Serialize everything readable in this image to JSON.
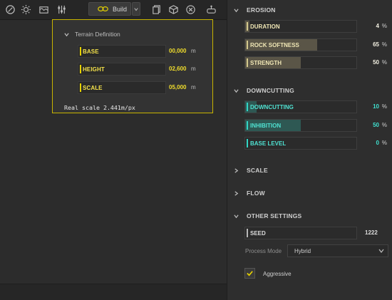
{
  "toolbar": {
    "icons": [
      "gauge-icon",
      "sun-icon",
      "terrain-graph-icon",
      "sliders-icon",
      "chain-link-icon",
      "chevron-down-icon",
      "copy-icon",
      "cube-icon",
      "close-circle-icon",
      "camera-pin-icon"
    ],
    "build_label": "Build"
  },
  "terrain": {
    "title": "Terrain Definition",
    "fields": [
      {
        "label": "BASE",
        "value": "00,000",
        "unit": "m"
      },
      {
        "label": "HEIGHT",
        "value": "02,600",
        "unit": "m"
      },
      {
        "label": "SCALE",
        "value": "05,000",
        "unit": "m"
      }
    ],
    "real_scale": "Real scale 2.441m/px"
  },
  "panel": {
    "erosion": {
      "title": "EROSION",
      "params": [
        {
          "label": "DURATION",
          "value": "4",
          "unit": "%",
          "fill": 0.04
        },
        {
          "label": "ROCK SOFTNESS",
          "value": "65",
          "unit": "%",
          "fill": 0.65
        },
        {
          "label": "STRENGTH",
          "value": "50",
          "unit": "%",
          "fill": 0.5
        }
      ]
    },
    "downcutting": {
      "title": "DOWNCUTTING",
      "params": [
        {
          "label": "DOWNCUTTING",
          "value": "10",
          "unit": "%",
          "fill": 0.1
        },
        {
          "label": "INHIBITION",
          "value": "50",
          "unit": "%",
          "fill": 0.5
        },
        {
          "label": "BASE LEVEL",
          "value": "0",
          "unit": "%",
          "fill": 0.0
        }
      ]
    },
    "scale": {
      "title": "SCALE"
    },
    "flow": {
      "title": "FLOW"
    },
    "other": {
      "title": "OTHER SETTINGS",
      "seed_label": "SEED",
      "seed_value": "1222",
      "process_mode_label": "Process Mode",
      "process_mode_value": "Hybrid",
      "aggressive_label": "Aggressive",
      "aggressive_checked": true
    }
  },
  "colors": {
    "accent_yellow": "#e6d200",
    "erosion_accent": "#d4c98d",
    "downcutting_accent": "#32d6c6"
  }
}
